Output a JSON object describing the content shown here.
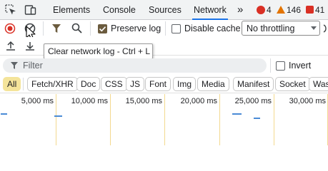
{
  "tabs": [
    {
      "label": "Elements"
    },
    {
      "label": "Console"
    },
    {
      "label": "Sources"
    },
    {
      "label": "Network"
    }
  ],
  "overflow_label": "»",
  "badges": {
    "errors": "4",
    "warnings": "146",
    "issues": "41"
  },
  "toolbar": {
    "preserve_log_label": "Preserve log",
    "disable_cache_label": "Disable cache",
    "throttling_value": "No throttling"
  },
  "tooltip": "Clear network log - Ctrl + L",
  "filter": {
    "placeholder": "Filter",
    "invert_label": "Invert"
  },
  "type_filters": [
    "All",
    "Fetch/XHR",
    "Doc",
    "CSS",
    "JS",
    "Font",
    "Img",
    "Media",
    "Manifest",
    "Socket",
    "Was"
  ],
  "timeline": {
    "ticks": [
      "5,000 ms",
      "10,000 ms",
      "15,000 ms",
      "20,000 ms",
      "25,000 ms",
      "30,000 ms"
    ]
  },
  "colors": {
    "active_tab_underline": "#1a73e8",
    "record_red": "#d93025",
    "active_chip": "#f4e49a",
    "gridline": "#f3d98f",
    "request_bar": "#4a8bd6"
  }
}
